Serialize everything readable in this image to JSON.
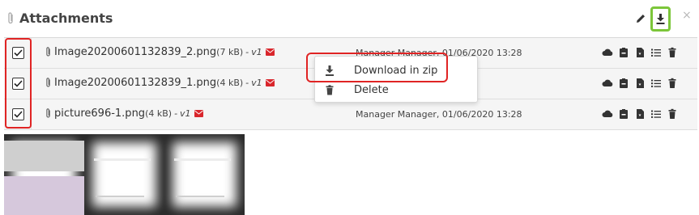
{
  "header": {
    "title": "Attachments",
    "close_glyph": "×",
    "icons": [
      "paperclip-icon",
      "pencil-icon",
      "download-icon",
      "close-icon"
    ]
  },
  "files": [
    {
      "name": "Image20200601132839_2.png",
      "size": "(7 kB)",
      "version": "v1",
      "meta": "Manager Manager, 01/06/2020 13:28",
      "checked": true
    },
    {
      "name": "Image20200601132839_1.png",
      "size": "(4 kB)",
      "version": "v1",
      "meta": "",
      "checked": true
    },
    {
      "name": "picture696-1.png",
      "size": "(4 kB)",
      "version": "v1",
      "meta": "Manager Manager, 01/06/2020 13:28",
      "checked": true
    }
  ],
  "row_action_icons": [
    "cloud-icon",
    "clipboard-icon",
    "file-download-icon",
    "list-icon",
    "trash-icon"
  ],
  "context_menu": {
    "items": [
      {
        "label": "Download in zip",
        "icon": "download-icon"
      },
      {
        "label": "Delete",
        "icon": "trash-icon"
      }
    ]
  },
  "version_prefix": " - ",
  "colors": {
    "highlight_red": "#e02424",
    "highlight_green": "#7cc63a",
    "mail_red": "#d9262c",
    "row_bg": "#f5f5f5"
  }
}
